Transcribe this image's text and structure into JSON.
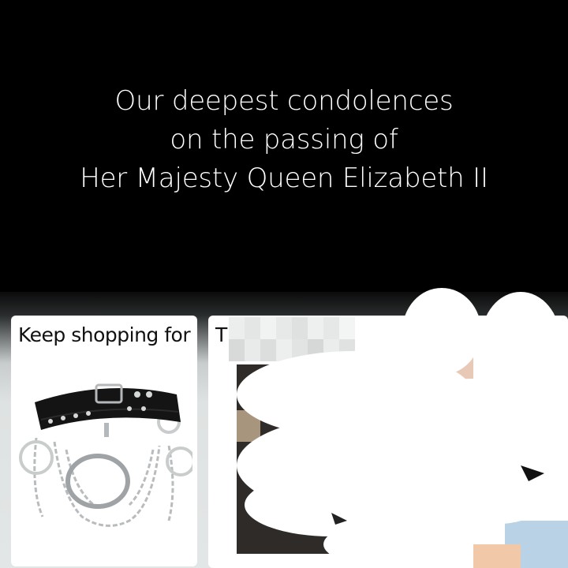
{
  "banner": {
    "lines": [
      "Our deepest condolences",
      "on the passing of",
      "Her Majesty Queen Elizabeth II"
    ]
  },
  "cards": [
    {
      "title": "Keep shopping for",
      "image_icon": "choker-necklace-image"
    },
    {
      "title": "T"
    }
  ],
  "colors": {
    "banner_bg": "#000000",
    "banner_text": "#ffffff",
    "page_bg": "#e3e6e6",
    "card_bg": "#ffffff"
  }
}
